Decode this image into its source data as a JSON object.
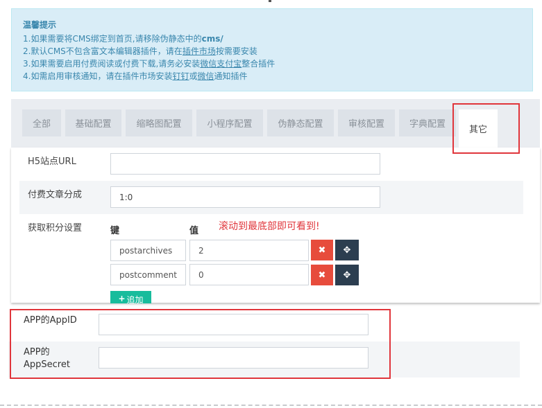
{
  "tips": {
    "title": "温馨提示",
    "line1_a": "1.如果需要将CMS绑定到首页,请移除伪静态中的",
    "line1_b": "cms/",
    "line2_a": "2.默认CMS不包含富文本编辑器插件，请在",
    "line2_link": "插件市场",
    "line2_b": "按需要安装",
    "line3_a": "3.如果需要启用付费阅读或付费下载,请务必安装",
    "line3_link1": "微信支付宝",
    "line3_link1_mid": "整合插件",
    "line4_a": "4.如需启用审核通知，请在插件市场安装",
    "line4_link1": "钉钉",
    "line4_mid": "或",
    "line4_link2": "微信",
    "line4_b": "通知插件"
  },
  "tabs": [
    {
      "label": "全部"
    },
    {
      "label": "基础配置"
    },
    {
      "label": "缩略图配置"
    },
    {
      "label": "小程序配置"
    },
    {
      "label": "伪静态配置"
    },
    {
      "label": "审核配置"
    },
    {
      "label": "字典配置"
    },
    {
      "label": "其它"
    }
  ],
  "active_tab": "其它",
  "form": {
    "h5_label": "H5站点URL",
    "h5_value": "",
    "split_label": "付费文章分成",
    "split_value": "1:0",
    "score_label": "获取积分设置",
    "key_header": "键",
    "value_header": "值",
    "rows": [
      {
        "key": "postarchives",
        "value": "2"
      },
      {
        "key": "postcomment",
        "value": "0"
      }
    ],
    "delete_icon": "✖",
    "move_icon": "✥",
    "add_label": "追加",
    "add_icon": "+"
  },
  "annotation": "滚动到最底部即可看到!",
  "app": {
    "appid_label": "APP的AppID",
    "appid_value": "",
    "secret_label_1": "APP的",
    "secret_label_2": "AppSecret",
    "secret_value": ""
  },
  "colors": {
    "highlight": "#e0353b",
    "danger": "#e74c3c",
    "dark": "#2c3e50",
    "success": "#18bc9c",
    "info_bg": "#d9edf7"
  }
}
